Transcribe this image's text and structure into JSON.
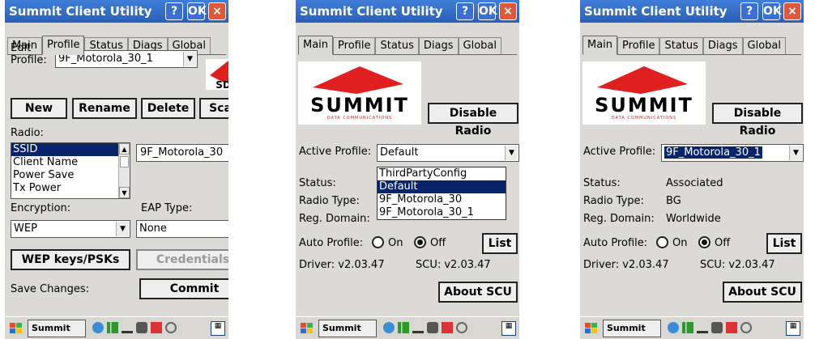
{
  "window": {
    "title": "Summit Client Utility",
    "help_label": "?",
    "ok_label": "OK",
    "close_label": "×"
  },
  "tabs": [
    "Main",
    "Profile",
    "Status",
    "Diags",
    "Global"
  ],
  "profile_screen": {
    "edit_profile_label": "Edit Profile:",
    "edit_profile_label_l1": "Edit",
    "edit_profile_label_l2": "Profile:",
    "edit_profile_value": "9F_Motorola_30_1",
    "logo_text": "SDC",
    "buttons": {
      "new": "New",
      "rename": "Rename",
      "delete": "Delete",
      "scan": "Scan"
    },
    "radio_label": "Radio:",
    "radio_list": [
      "SSID",
      "Client Name",
      "Power Save",
      "Tx Power"
    ],
    "radio_selected": "SSID",
    "ssid_value": "9F_Motorola_30",
    "encryption_label": "Encryption:",
    "encryption_value": "WEP",
    "eap_label": "EAP Type:",
    "eap_value": "None",
    "wep_button": "WEP keys/PSKs",
    "credentials_button": "Credentials",
    "save_changes_label": "Save Changes:",
    "commit_button": "Commit"
  },
  "main_screen_dropdown": {
    "logo_word": "SUMMIT",
    "logo_sub": "DATA COMMUNICATIONS",
    "disable_radio_button": "Disable Radio",
    "active_profile_label": "Active Profile:",
    "active_profile_value": "Default",
    "dropdown_options": [
      "ThirdPartyConfig",
      "Default",
      "9F_Motorola_30",
      "9F_Motorola_30_1"
    ],
    "dropdown_selected": "Default",
    "status_label": "Status:",
    "radio_type_label": "Radio Type:",
    "reg_domain_label": "Reg. Domain:",
    "auto_profile_label": "Auto Profile:",
    "on_label": "On",
    "off_label": "Off",
    "list_button": "List",
    "driver_text": "Driver:  v2.03.47",
    "scu_text": "SCU: v2.03.47",
    "about_button": "About SCU"
  },
  "main_screen_final": {
    "active_profile_value": "9F_Motorola_30_1",
    "status_value": "Associated",
    "radio_type_value": "BG",
    "reg_domain_value": "Worldwide"
  },
  "taskbar": {
    "app_label": "Summit ...",
    "keyboard_icon": "keyboard-icon"
  },
  "colors": {
    "title_blue": "#3f7fd9",
    "selection": "#0a246a",
    "logo_red": "#e0201e",
    "form_bg": "#dbdad6"
  }
}
